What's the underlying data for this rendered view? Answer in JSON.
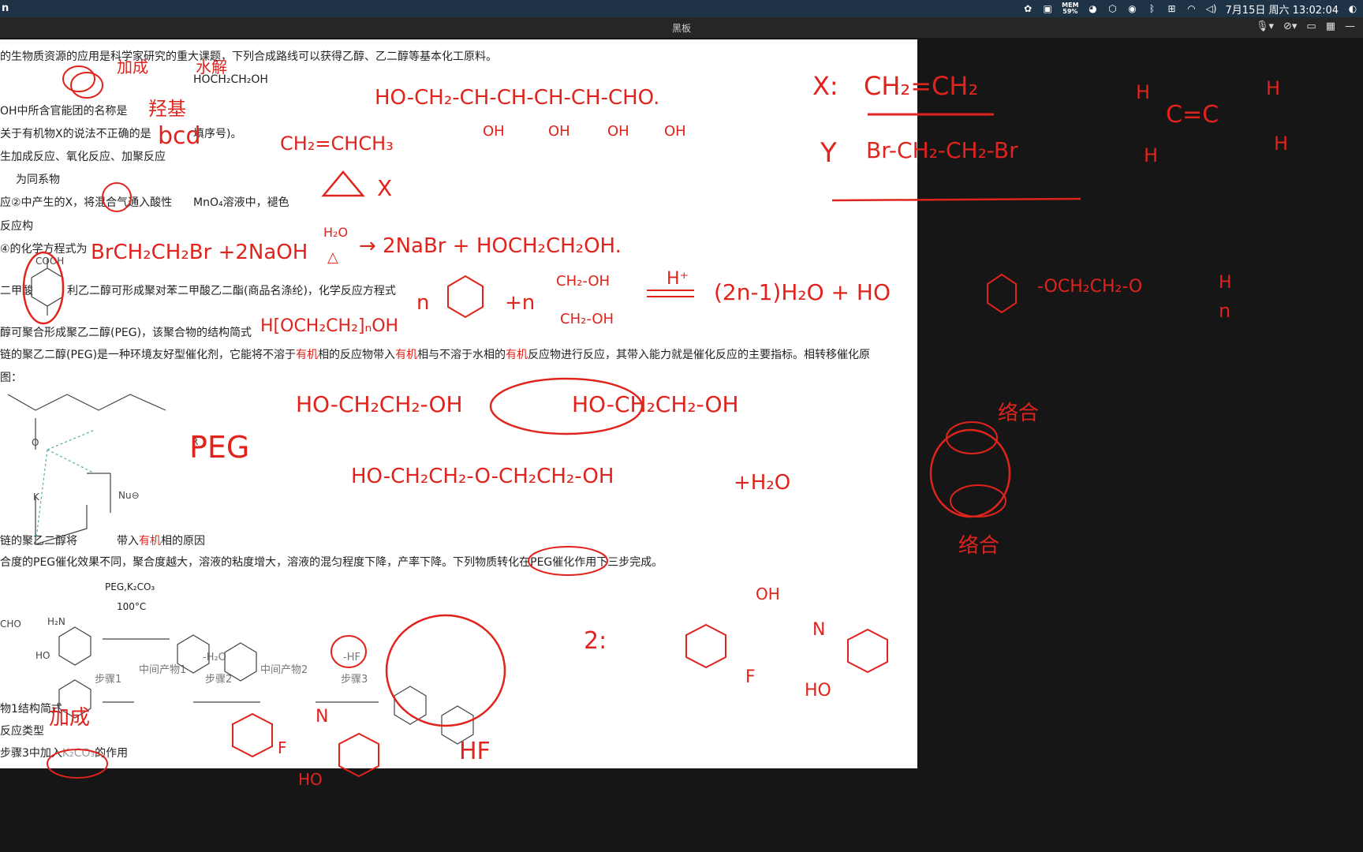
{
  "menubar": {
    "app_title": "n",
    "mem_label": "MEM",
    "mem_value": "59%",
    "clock": "7月15日 周六 13:02:04",
    "icons": [
      "flower-icon",
      "chat-icon",
      "wechat-icon",
      "shield-icon",
      "accessibility-icon",
      "bluetooth-icon",
      "input-method-icon",
      "wifi-icon",
      "volume-icon"
    ]
  },
  "window": {
    "title": "黑板"
  },
  "toolbar": {
    "icons": [
      "microphone-icon",
      "camera-off-icon",
      "video-icon",
      "grid-icon",
      "minimize-icon"
    ]
  },
  "document": {
    "lines": [
      "的生物质资源的应用是科学家研究的重大课题，下列合成路线可以获得乙醇、乙二醇等基本化工原料。",
      "HOCH₂CH₂OH",
      "OH中所含官能团的名称是",
      "关于有机物X的说法不正确的是",
      "填序号)。",
      "生加成反应、氧化反应、加聚反应",
      "为同系物",
      "应②中产生的X，将混合气通入酸性",
      "MnO₄溶液中，褪色",
      "反应构",
      "④的化学方程式为",
      "二甲酸",
      "利乙二醇可形成聚对苯二甲酸乙二酯(商品名涤纶)，化学反应方程式",
      "醇可聚合形成聚乙二醇(PEG)，该聚合物的结构简式",
      "链的聚乙二醇(PEG)是一种环境友好型催化剂，它能将不溶于",
      "有机",
      "相的反应物带入",
      "有机",
      "相与不溶于水相的",
      "有机",
      "反应物进行反应，其带入能力就是催化反应的主要指标。相转移催化原",
      "图：",
      "链的聚乙二醇将",
      "带入",
      "有机",
      "相的原因",
      "合度的PEG催化效果不同，聚合度越大，溶液的粘度增大，溶液的混匀程度下降，产率下降。下列物质转化在PEG催化作用下三步完成。",
      "PEG,K₂CO₃",
      "100°C",
      "步骤1",
      "中间产物1",
      "-H₂O",
      "步骤2",
      "中间产物2",
      "-HF",
      "步骤3",
      "物1结构简式",
      "反应类型",
      "步骤3中加入",
      "K₂CO₃",
      "的作用",
      "COOH",
      "CHO",
      "H₂N",
      "HO",
      "Nu⊖",
      "R",
      "O",
      "K"
    ]
  },
  "annotations": [
    "加成",
    "水解",
    "羟基",
    "bcd",
    "HO-CH₂-CH-CH-CH-CH-CHO.",
    "OH",
    "CH₂=CHCH₃",
    "X",
    "X:",
    "CH₂=CH₂",
    "Y",
    "Br-CH₂-CH₂-Br",
    "H",
    "C=C",
    "BrCH₂CH₂Br +2NaOH",
    "H₂O",
    "△",
    "→ 2NaBr + HOCH₂CH₂OH.",
    "n",
    "+n",
    "CH₂-OH",
    "H⁺",
    "(2n-1)H₂O + HO",
    "-OCH₂CH₂-O",
    "H",
    "n",
    "H[OCH₂CH₂]ₙOH",
    "PEG",
    "HO-CH₂CH₂-OH",
    "HO-CH₂CH₂-OH",
    "HO-CH₂CH₂-O-CH₂CH₂-OH",
    "+H₂O",
    "络合",
    "2:",
    "F",
    "N",
    "加成",
    "HF",
    "HO"
  ]
}
